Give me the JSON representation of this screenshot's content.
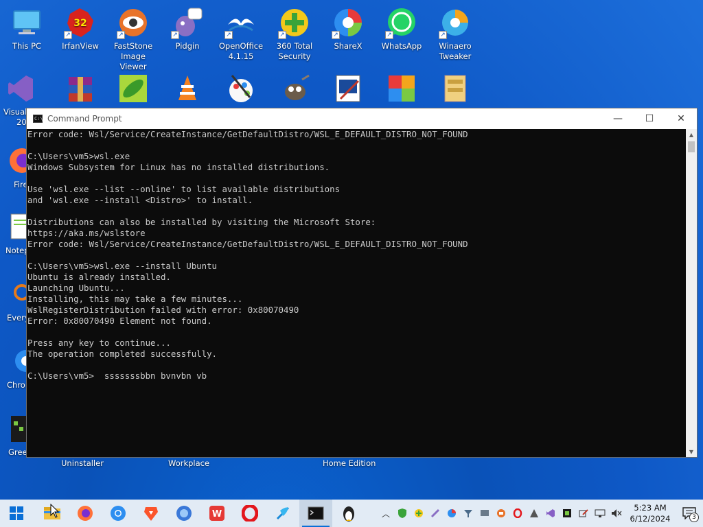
{
  "desktop_icons_row1": [
    {
      "label": "This PC",
      "name": "this-pc-icon"
    },
    {
      "label": "IrfanView",
      "name": "irfanview-icon"
    },
    {
      "label": "FastStone Image Viewer",
      "name": "faststone-icon"
    },
    {
      "label": "Pidgin",
      "name": "pidgin-icon"
    },
    {
      "label": "OpenOffice 4.1.15",
      "name": "openoffice-icon"
    },
    {
      "label": "360 Total Security",
      "name": "360-total-security-icon"
    },
    {
      "label": "ShareX",
      "name": "sharex-icon"
    },
    {
      "label": "WhatsApp",
      "name": "whatsapp-icon"
    },
    {
      "label": "Winaero Tweaker",
      "name": "winaero-tweaker-icon"
    }
  ],
  "desktop_icons_left": [
    {
      "label": "Visual",
      "label2": "20",
      "name": "visual-studio-icon"
    },
    {
      "label": "Fire",
      "name": "firefox-icon"
    },
    {
      "label": "Notep",
      "name": "notepad-icon"
    },
    {
      "label": "Every",
      "name": "everything-icon"
    },
    {
      "label": "Chron",
      "name": "chrome-icon"
    },
    {
      "label": "Greer",
      "name": "greenshot-icon"
    }
  ],
  "bottom_labels": {
    "uninstaller": "Uninstaller",
    "workplace": "Workplace",
    "home_edition": "Home Edition"
  },
  "window": {
    "title": "Command Prompt",
    "icon_text": "C:\\",
    "minimize": "—",
    "maximize": "☐",
    "close": "✕"
  },
  "console_lines": [
    "Error code: Wsl/Service/CreateInstance/GetDefaultDistro/WSL_E_DEFAULT_DISTRO_NOT_FOUND",
    "",
    "C:\\Users\\vm5>wsl.exe",
    "Windows Subsystem for Linux has no installed distributions.",
    "",
    "Use 'wsl.exe --list --online' to list available distributions",
    "and 'wsl.exe --install <Distro>' to install.",
    "",
    "Distributions can also be installed by visiting the Microsoft Store:",
    "https://aka.ms/wslstore",
    "Error code: Wsl/Service/CreateInstance/GetDefaultDistro/WSL_E_DEFAULT_DISTRO_NOT_FOUND",
    "",
    "C:\\Users\\vm5>wsl.exe --install Ubuntu",
    "Ubuntu is already installed.",
    "Launching Ubuntu...",
    "Installing, this may take a few minutes...",
    "WslRegisterDistribution failed with error: 0x80070490",
    "Error: 0x80070490 Element not found.",
    "",
    "Press any key to continue...",
    "The operation completed successfully.",
    "",
    "C:\\Users\\vm5>  sssssssbbn bvnvbn vb"
  ],
  "taskbar": {
    "items": [
      "start-button",
      "file-explorer-taskbar",
      "firefox-taskbar",
      "chrome-taskbar",
      "brave-taskbar",
      "edge-taskbar",
      "wps-taskbar",
      "opera-taskbar",
      "app-taskbar",
      "command-prompt-taskbar",
      "linux-taskbar"
    ]
  },
  "tray": {
    "time": "5:23 AM",
    "date": "6/12/2024",
    "notification_count": "3"
  },
  "colors": {
    "console_bg": "#0c0c0c",
    "console_text": "#cccccc",
    "taskbar_bg": "#e2ebf5"
  }
}
